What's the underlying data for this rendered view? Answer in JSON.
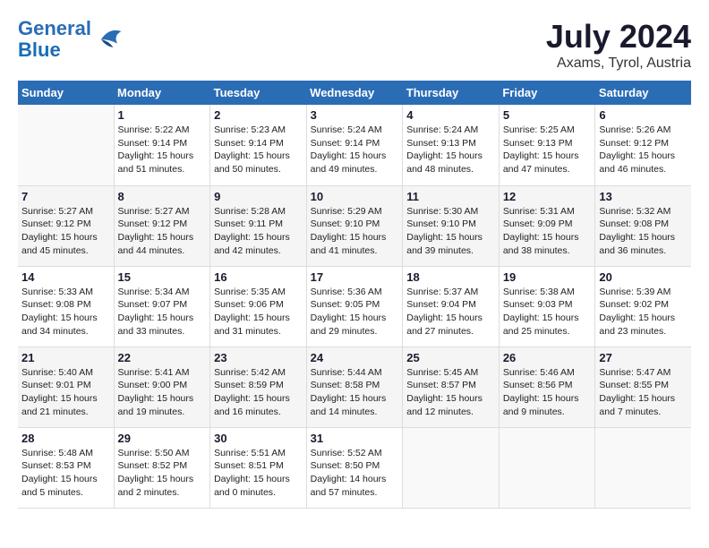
{
  "header": {
    "logo_line1": "General",
    "logo_line2": "Blue",
    "main_title": "July 2024",
    "subtitle": "Axams, Tyrol, Austria"
  },
  "calendar": {
    "days_of_week": [
      "Sunday",
      "Monday",
      "Tuesday",
      "Wednesday",
      "Thursday",
      "Friday",
      "Saturday"
    ],
    "weeks": [
      [
        {
          "day": "",
          "info": ""
        },
        {
          "day": "1",
          "info": "Sunrise: 5:22 AM\nSunset: 9:14 PM\nDaylight: 15 hours\nand 51 minutes."
        },
        {
          "day": "2",
          "info": "Sunrise: 5:23 AM\nSunset: 9:14 PM\nDaylight: 15 hours\nand 50 minutes."
        },
        {
          "day": "3",
          "info": "Sunrise: 5:24 AM\nSunset: 9:14 PM\nDaylight: 15 hours\nand 49 minutes."
        },
        {
          "day": "4",
          "info": "Sunrise: 5:24 AM\nSunset: 9:13 PM\nDaylight: 15 hours\nand 48 minutes."
        },
        {
          "day": "5",
          "info": "Sunrise: 5:25 AM\nSunset: 9:13 PM\nDaylight: 15 hours\nand 47 minutes."
        },
        {
          "day": "6",
          "info": "Sunrise: 5:26 AM\nSunset: 9:12 PM\nDaylight: 15 hours\nand 46 minutes."
        }
      ],
      [
        {
          "day": "7",
          "info": "Sunrise: 5:27 AM\nSunset: 9:12 PM\nDaylight: 15 hours\nand 45 minutes."
        },
        {
          "day": "8",
          "info": "Sunrise: 5:27 AM\nSunset: 9:12 PM\nDaylight: 15 hours\nand 44 minutes."
        },
        {
          "day": "9",
          "info": "Sunrise: 5:28 AM\nSunset: 9:11 PM\nDaylight: 15 hours\nand 42 minutes."
        },
        {
          "day": "10",
          "info": "Sunrise: 5:29 AM\nSunset: 9:10 PM\nDaylight: 15 hours\nand 41 minutes."
        },
        {
          "day": "11",
          "info": "Sunrise: 5:30 AM\nSunset: 9:10 PM\nDaylight: 15 hours\nand 39 minutes."
        },
        {
          "day": "12",
          "info": "Sunrise: 5:31 AM\nSunset: 9:09 PM\nDaylight: 15 hours\nand 38 minutes."
        },
        {
          "day": "13",
          "info": "Sunrise: 5:32 AM\nSunset: 9:08 PM\nDaylight: 15 hours\nand 36 minutes."
        }
      ],
      [
        {
          "day": "14",
          "info": "Sunrise: 5:33 AM\nSunset: 9:08 PM\nDaylight: 15 hours\nand 34 minutes."
        },
        {
          "day": "15",
          "info": "Sunrise: 5:34 AM\nSunset: 9:07 PM\nDaylight: 15 hours\nand 33 minutes."
        },
        {
          "day": "16",
          "info": "Sunrise: 5:35 AM\nSunset: 9:06 PM\nDaylight: 15 hours\nand 31 minutes."
        },
        {
          "day": "17",
          "info": "Sunrise: 5:36 AM\nSunset: 9:05 PM\nDaylight: 15 hours\nand 29 minutes."
        },
        {
          "day": "18",
          "info": "Sunrise: 5:37 AM\nSunset: 9:04 PM\nDaylight: 15 hours\nand 27 minutes."
        },
        {
          "day": "19",
          "info": "Sunrise: 5:38 AM\nSunset: 9:03 PM\nDaylight: 15 hours\nand 25 minutes."
        },
        {
          "day": "20",
          "info": "Sunrise: 5:39 AM\nSunset: 9:02 PM\nDaylight: 15 hours\nand 23 minutes."
        }
      ],
      [
        {
          "day": "21",
          "info": "Sunrise: 5:40 AM\nSunset: 9:01 PM\nDaylight: 15 hours\nand 21 minutes."
        },
        {
          "day": "22",
          "info": "Sunrise: 5:41 AM\nSunset: 9:00 PM\nDaylight: 15 hours\nand 19 minutes."
        },
        {
          "day": "23",
          "info": "Sunrise: 5:42 AM\nSunset: 8:59 PM\nDaylight: 15 hours\nand 16 minutes."
        },
        {
          "day": "24",
          "info": "Sunrise: 5:44 AM\nSunset: 8:58 PM\nDaylight: 15 hours\nand 14 minutes."
        },
        {
          "day": "25",
          "info": "Sunrise: 5:45 AM\nSunset: 8:57 PM\nDaylight: 15 hours\nand 12 minutes."
        },
        {
          "day": "26",
          "info": "Sunrise: 5:46 AM\nSunset: 8:56 PM\nDaylight: 15 hours\nand 9 minutes."
        },
        {
          "day": "27",
          "info": "Sunrise: 5:47 AM\nSunset: 8:55 PM\nDaylight: 15 hours\nand 7 minutes."
        }
      ],
      [
        {
          "day": "28",
          "info": "Sunrise: 5:48 AM\nSunset: 8:53 PM\nDaylight: 15 hours\nand 5 minutes."
        },
        {
          "day": "29",
          "info": "Sunrise: 5:50 AM\nSunset: 8:52 PM\nDaylight: 15 hours\nand 2 minutes."
        },
        {
          "day": "30",
          "info": "Sunrise: 5:51 AM\nSunset: 8:51 PM\nDaylight: 15 hours\nand 0 minutes."
        },
        {
          "day": "31",
          "info": "Sunrise: 5:52 AM\nSunset: 8:50 PM\nDaylight: 14 hours\nand 57 minutes."
        },
        {
          "day": "",
          "info": ""
        },
        {
          "day": "",
          "info": ""
        },
        {
          "day": "",
          "info": ""
        }
      ]
    ]
  }
}
